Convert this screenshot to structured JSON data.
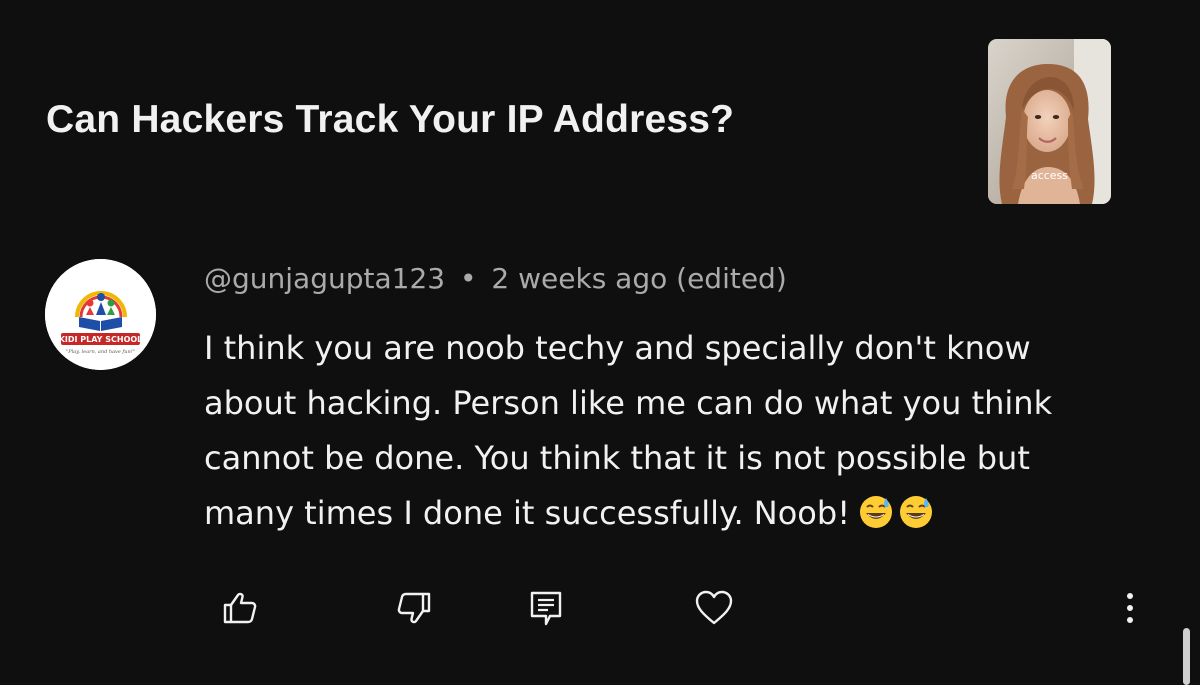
{
  "video": {
    "title": "Can Hackers Track Your IP Address?",
    "thumbnail_caption": "access"
  },
  "comment": {
    "author": "@gunjagupta123",
    "separator": "•",
    "time": "2 weeks ago (edited)",
    "text_lines": [
      "I think you are noob techy and specially don't know",
      "about hacking. Person like me can do what you think",
      "cannot be done. You think that it is not possible but",
      "many times I done it successfully. Noob!"
    ],
    "emojis": [
      "grinning-face-with-sweat",
      "grinning-face-with-sweat"
    ],
    "avatar": {
      "brand_text": "KIDI PLAY SCHOOL",
      "tagline": "\"Play, learn, and have fun!\""
    }
  },
  "actions": {
    "like_icon": "thumbs-up-icon",
    "dislike_icon": "thumbs-down-icon",
    "reply_icon": "reply-icon",
    "heart_icon": "heart-icon",
    "more_icon": "more-vertical-icon"
  },
  "colors": {
    "background": "#0f0f0f",
    "primary_text": "#f1f1f1",
    "secondary_text": "#aaaaaa"
  }
}
